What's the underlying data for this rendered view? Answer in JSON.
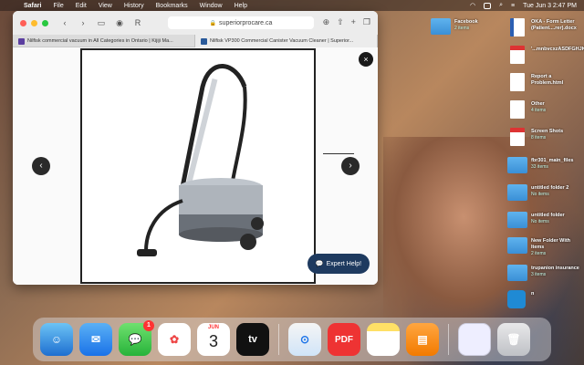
{
  "menubar": {
    "app": "Safari",
    "items": [
      "File",
      "Edit",
      "View",
      "History",
      "Bookmarks",
      "Window",
      "Help"
    ],
    "clock": "Tue Jun 3  2:47 PM"
  },
  "safari": {
    "address": "superiorprocare.ca",
    "tabs": [
      {
        "title": "Nilfisk commercial vacuum in All Categories in Ontario | Kijiji Ma..."
      },
      {
        "title": "Nilfisk VP300 Commercial Canister Vacuum Cleaner | Superior..."
      }
    ],
    "expert_button": "Expert Help!",
    "close_glyph": "×",
    "prev_glyph": "‹",
    "next_glyph": "›"
  },
  "desktop_icons": [
    {
      "name": "Facebook",
      "sub": "2 items",
      "type": "folder"
    },
    {
      "name": "OKA - Form Letter (Patient....rer).docx",
      "sub": "",
      "type": "doc"
    },
    {
      "name": "'...mnbvcxzASDFGHJKL;'",
      "sub": "",
      "type": "doc"
    },
    {
      "name": "Report a Problem.html",
      "sub": "",
      "type": "doc"
    },
    {
      "name": "Other",
      "sub": "4 items",
      "type": "folder"
    },
    {
      "name": "Screen Shots",
      "sub": "8 items",
      "type": "folder"
    },
    {
      "name": "fbr301_main_files",
      "sub": "33 items",
      "type": "folder"
    },
    {
      "name": "untitled folder 2",
      "sub": "No items",
      "type": "folder"
    },
    {
      "name": "untitled folder",
      "sub": "No items",
      "type": "folder"
    },
    {
      "name": "New Folder With Items",
      "sub": "2 items",
      "type": "folder"
    },
    {
      "name": "trupanion insurance",
      "sub": "3 items",
      "type": "folder"
    },
    {
      "name": "n",
      "sub": "",
      "type": "app"
    }
  ],
  "dock": {
    "messages_badge": "1",
    "calendar_month": "JUN",
    "calendar_day": "3",
    "tv_label": "tv",
    "pdf_label": "PDF"
  },
  "colors": {
    "expert_button": "#1e3a5f",
    "folder": "#4aa3e8"
  }
}
